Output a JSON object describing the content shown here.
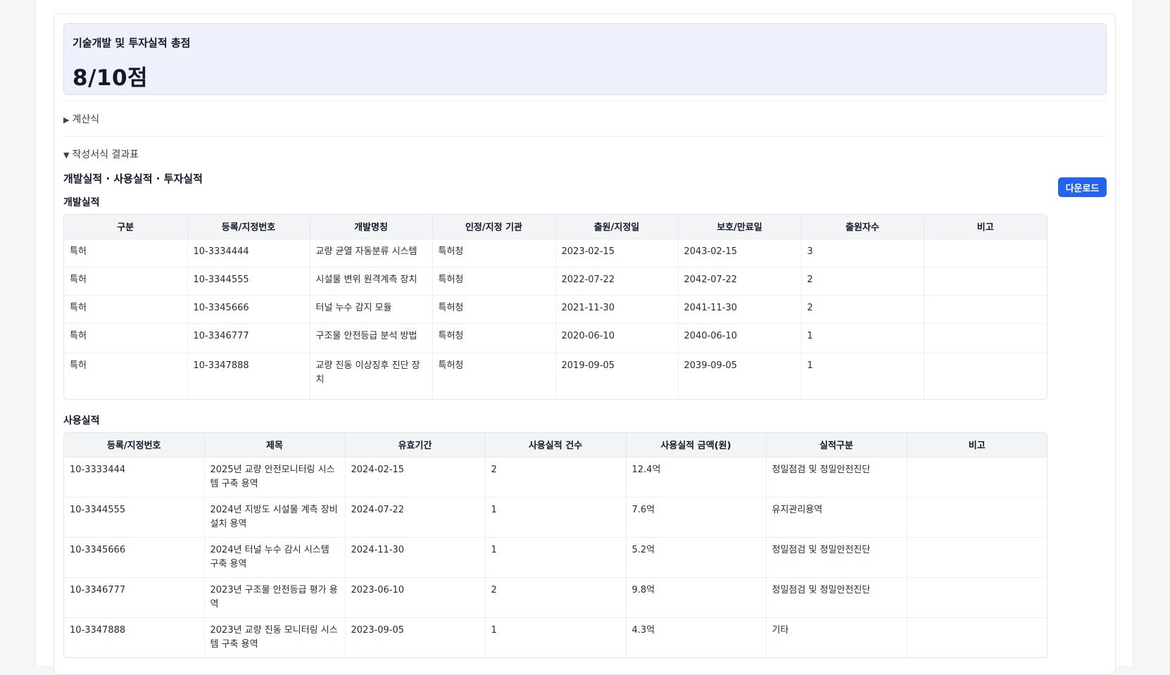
{
  "summary": {
    "label": "기술개발 및 투자실적 총점",
    "value": "8/10점"
  },
  "toggles": {
    "formula": "계산식",
    "results": "작성서식 결과표"
  },
  "section": {
    "title": "개발실적 · 사용실적 · 투자실적",
    "download_label": "다운로드"
  },
  "development": {
    "title": "개발실적",
    "headers": [
      "구분",
      "등록/지정번호",
      "개발명칭",
      "인정/지정 기관",
      "출원/지정일",
      "보호/만료일",
      "출원자수",
      "비고"
    ],
    "rows": [
      [
        "특허",
        "10-3334444",
        "교량 균열 자동분류 시스템",
        "특허청",
        "2023-02-15",
        "2043-02-15",
        "3",
        ""
      ],
      [
        "특허",
        "10-3344555",
        "시설물 변위 원격계측 장치",
        "특허청",
        "2022-07-22",
        "2042-07-22",
        "2",
        ""
      ],
      [
        "특허",
        "10-3345666",
        "터널 누수 감지 모듈",
        "특허청",
        "2021-11-30",
        "2041-11-30",
        "2",
        ""
      ],
      [
        "특허",
        "10-3346777",
        "구조물 안전등급 분석 방법",
        "특허청",
        "2020-06-10",
        "2040-06-10",
        "1",
        ""
      ],
      [
        "특허",
        "10-3347888",
        "교량 진동 이상징후 진단 장치",
        "특허청",
        "2019-09-05",
        "2039-09-05",
        "1",
        ""
      ]
    ]
  },
  "usage": {
    "title": "사용실적",
    "headers": [
      "등록/지정번호",
      "제목",
      "유효기간",
      "사용실적 건수",
      "사용실적 금액(원)",
      "실적구분",
      "비고"
    ],
    "rows": [
      [
        "10-3333444",
        "2025년 교량 안전모니터링 시스템 구축 용역",
        "2024-02-15",
        "2",
        "12.4억",
        "정밀점검 및 정밀안전진단",
        ""
      ],
      [
        "10-3344555",
        "2024년 지방도 시설물 계측 장비 설치 용역",
        "2024-07-22",
        "1",
        "7.6억",
        "유지관리용역",
        ""
      ],
      [
        "10-3345666",
        "2024년 터널 누수 감시 시스템 구축 용역",
        "2024-11-30",
        "1",
        "5.2억",
        "정밀점검 및 정밀안전진단",
        ""
      ],
      [
        "10-3346777",
        "2023년 구조물 안전등급 평가 용역",
        "2023-06-10",
        "2",
        "9.8억",
        "정밀점검 및 정밀안전진단",
        ""
      ],
      [
        "10-3347888",
        "2023년 교량 진동 모니터링 시스템 구축 용역",
        "2023-09-05",
        "1",
        "4.3억",
        "기타",
        ""
      ]
    ]
  }
}
